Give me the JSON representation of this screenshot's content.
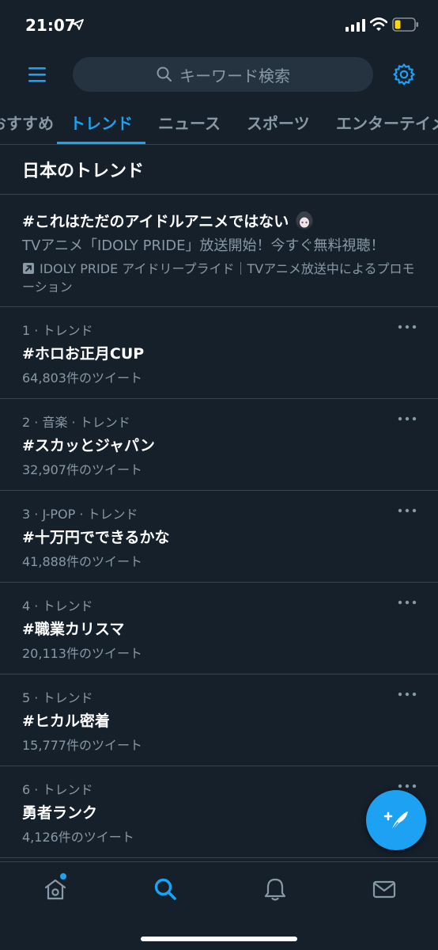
{
  "status_bar": {
    "time": "21:07"
  },
  "header": {
    "search_placeholder": "キーワード検索"
  },
  "tabs": [
    {
      "label": "おすすめ"
    },
    {
      "label": "トレンド"
    },
    {
      "label": "ニュース"
    },
    {
      "label": "スポーツ"
    },
    {
      "label": "エンターテイメント"
    }
  ],
  "section_title": "日本のトレンド",
  "promoted": {
    "title": "#これはただのアイドルアニメではない",
    "description": "TVアニメ「IDOLY PRIDE」放送開始！今すぐ無料視聴！",
    "promoted_by": "IDOLY PRIDE アイドリープライド｜TVアニメ放送中によるプロモーション"
  },
  "trends": [
    {
      "meta": "1 · トレンド",
      "name": "#ホロお正月CUP",
      "count": "64,803件のツイート"
    },
    {
      "meta": "2 · 音楽 · トレンド",
      "name": "#スカッとジャパン",
      "count": "32,907件のツイート"
    },
    {
      "meta": "3 · J-POP · トレンド",
      "name": "#十万円でできるかな",
      "count": "41,888件のツイート"
    },
    {
      "meta": "4 · トレンド",
      "name": "#職業カリスマ",
      "count": "20,113件のツイート"
    },
    {
      "meta": "5 · トレンド",
      "name": "#ヒカル密着",
      "count": "15,777件のツイート"
    },
    {
      "meta": "6 · トレンド",
      "name": "勇者ランク",
      "count": "4,126件のツイート"
    }
  ],
  "colors": {
    "background": "#15202b",
    "accent": "#1da1f2",
    "secondary_text": "#8899a6",
    "divider": "#38444d",
    "battery_fill": "#ffd60a"
  },
  "icons": {
    "menu": "hamburger-icon",
    "search": "search-icon",
    "settings": "gear-icon",
    "more": "more-dots-icon",
    "compose": "compose-tweet-icon",
    "home": "home-icon",
    "explore": "search-icon",
    "notifications": "bell-icon",
    "messages": "mail-icon"
  }
}
